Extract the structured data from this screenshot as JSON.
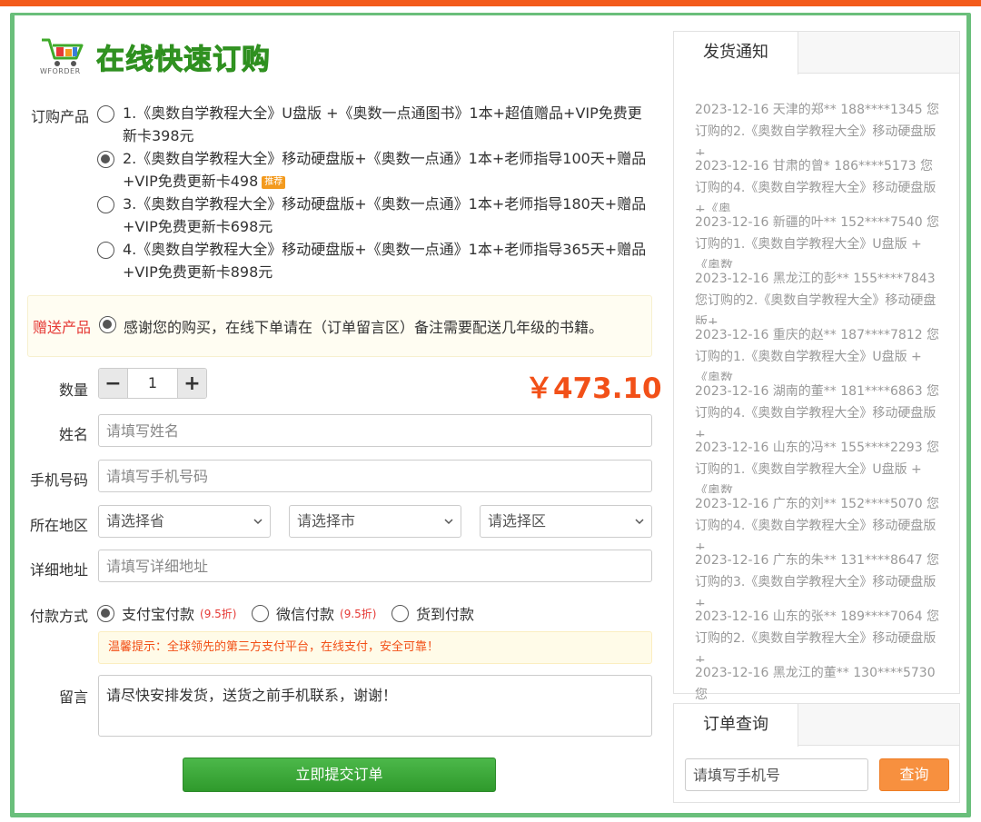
{
  "brand": {
    "logo_text": "WFORDER",
    "title": "在线快速订购",
    "colors": {
      "accent": "#f35b1b",
      "frame": "#6abf7b",
      "title_green": "#3faa2a",
      "price": "#f25018"
    }
  },
  "product": {
    "label": "订购产品",
    "options": [
      {
        "text": "1.《奥数自学教程大全》U盘版 +《奥数一点通图书》1本+超值赠品+VIP免费更新卡398元",
        "checked": false,
        "badge": ""
      },
      {
        "text": "2.《奥数自学教程大全》移动硬盘版+《奥数一点通》1本+老师指导100天+赠品+VIP免费更新卡498",
        "checked": true,
        "badge": "推荐"
      },
      {
        "text": "3.《奥数自学教程大全》移动硬盘版+《奥数一点通》1本+老师指导180天+赠品+VIP免费更新卡698元",
        "checked": false,
        "badge": ""
      },
      {
        "text": "4.《奥数自学教程大全》移动硬盘版+《奥数一点通》1本+老师指导365天+赠品+VIP免费更新卡898元",
        "checked": false,
        "badge": ""
      }
    ]
  },
  "gift": {
    "label": "赠送产品",
    "text": "感谢您的购买，在线下单请在（订单留言区）备注需要配送几年级的书籍。"
  },
  "quantity": {
    "label": "数量",
    "value": "1",
    "minus": "−",
    "plus": "+"
  },
  "price": "￥473.10",
  "name_field": {
    "label": "姓名",
    "placeholder": "请填写姓名"
  },
  "phone_field": {
    "label": "手机号码",
    "placeholder": "请填写手机号码"
  },
  "region": {
    "label": "所在地区",
    "province": "请选择省",
    "city": "请选择市",
    "district": "请选择区"
  },
  "address_field": {
    "label": "详细地址",
    "placeholder": "请填写详细地址"
  },
  "payment": {
    "label": "付款方式",
    "options": [
      {
        "text": "支付宝付款",
        "discount": "(9.5折)",
        "checked": true
      },
      {
        "text": "微信付款",
        "discount": "(9.5折)",
        "checked": false
      },
      {
        "text": "货到付款",
        "discount": "",
        "checked": false
      }
    ],
    "tip": "温馨提示：全球领先的第三方支付平台，在线支付，安全可靠！"
  },
  "message": {
    "label": "留言",
    "value": "请尽快安排发货，送货之前手机联系，谢谢！"
  },
  "submit_label": "立即提交订单",
  "notice": {
    "title": "发货通知",
    "items": [
      "2023-12-16 天津的郑** 188****1345 您订购的2.《奥数自学教程大全》移动硬盘版+",
      "2023-12-16 甘肃的曾* 186****5173 您订购的4.《奥数自学教程大全》移动硬盘版+《奥",
      "2023-12-16 新疆的叶** 152****7540 您订购的1.《奥数自学教程大全》U盘版 +《奥数",
      "2023-12-16 黑龙江的彭** 155****7843 您订购的2.《奥数自学教程大全》移动硬盘版+",
      "2023-12-16 重庆的赵** 187****7812 您订购的1.《奥数自学教程大全》U盘版 +《奥数",
      "2023-12-16 湖南的董** 181****6863 您订购的4.《奥数自学教程大全》移动硬盘版+",
      "2023-12-16 山东的冯** 155****2293 您订购的1.《奥数自学教程大全》U盘版 +《奥数",
      "2023-12-16 广东的刘** 152****5070 您订购的4.《奥数自学教程大全》移动硬盘版+",
      "2023-12-16 广东的朱** 131****8647 您订购的3.《奥数自学教程大全》移动硬盘版+",
      "2023-12-16 山东的张** 189****7064 您订购的2.《奥数自学教程大全》移动硬盘版+",
      "2023-12-16 黑龙江的董** 130****5730 您"
    ]
  },
  "query": {
    "title": "订单查询",
    "placeholder": "请填写手机号",
    "button": "查询"
  }
}
